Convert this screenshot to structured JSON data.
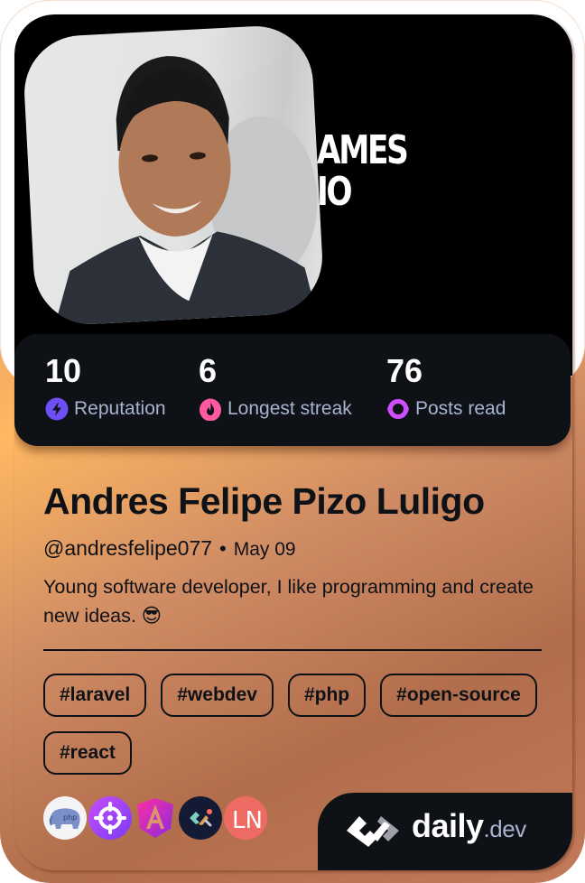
{
  "cover": {
    "background_text_lines": [
      "AMES",
      "IO"
    ]
  },
  "stats": [
    {
      "value": "10",
      "label": "Reputation",
      "icon": "bolt-icon",
      "color": "#6e4ff6"
    },
    {
      "value": "6",
      "label": "Longest streak",
      "icon": "flame-icon",
      "color": "#ff5aa0"
    },
    {
      "value": "76",
      "label": "Posts read",
      "icon": "ring-icon",
      "color": "#d04dff"
    }
  ],
  "profile": {
    "name": "Andres Felipe Pizo Luligo",
    "handle": "@andresfelipe077",
    "separator": "•",
    "date": "May 09",
    "bio": "Young software developer, I like programming and create new ideas. 😎"
  },
  "tags": [
    "#laravel",
    "#webdev",
    "#php",
    "#open-source",
    "#react"
  ],
  "sources": [
    {
      "name": "php-elephant-icon"
    },
    {
      "name": "crosshair-icon"
    },
    {
      "name": "angular-icon"
    },
    {
      "name": "dev-logo-icon"
    },
    {
      "name": "ln-icon",
      "text": "LN"
    }
  ],
  "brand": {
    "name": "daily",
    "tld": ".dev"
  },
  "colors": {
    "dark": "#0e1217",
    "muted": "#a8b3cf",
    "accent_copper": "#ffb862"
  }
}
